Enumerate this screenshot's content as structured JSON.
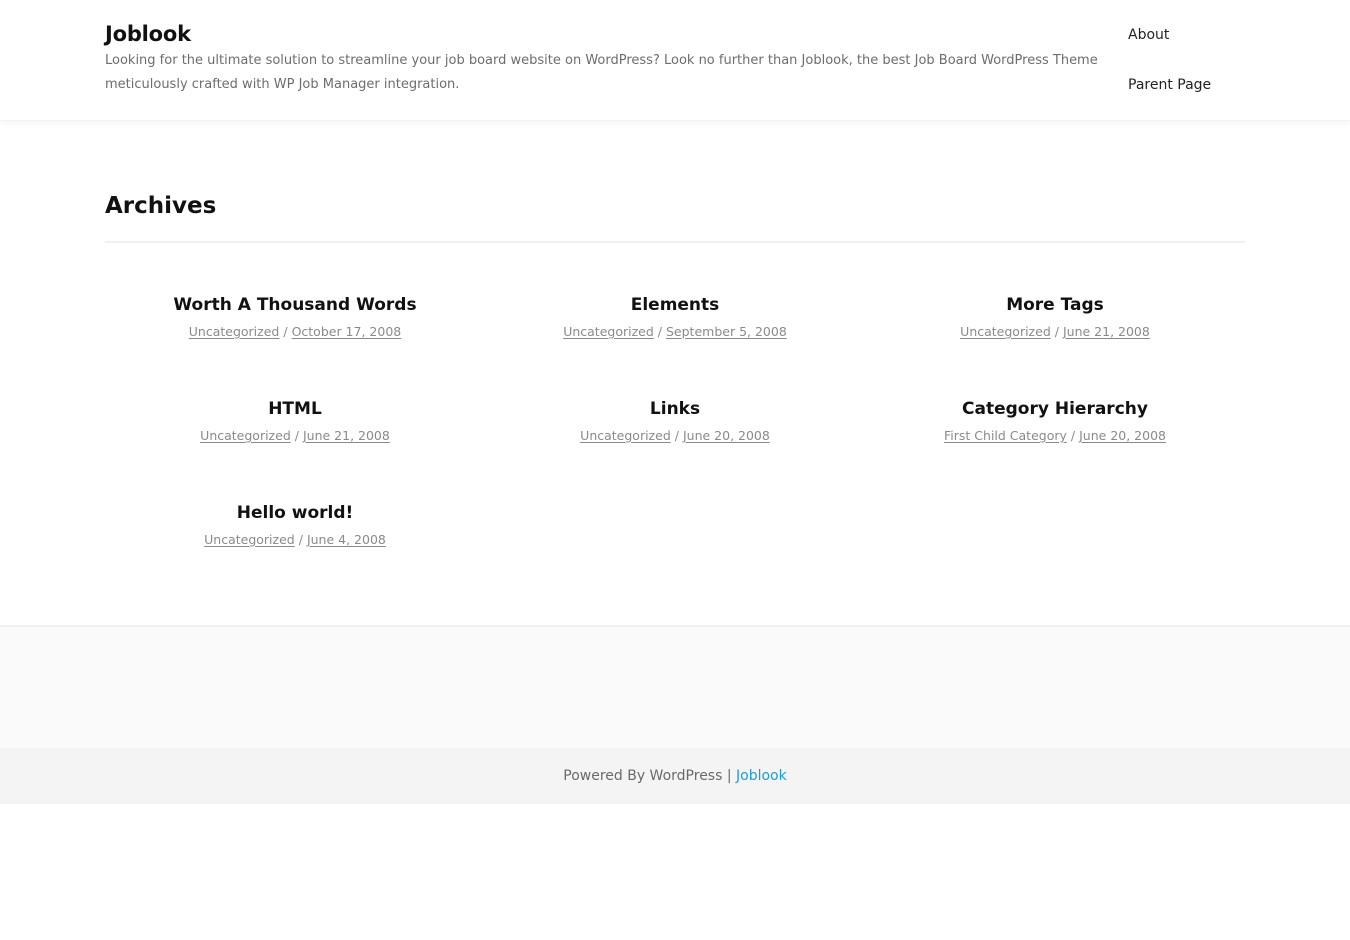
{
  "header": {
    "site_title": "Joblook",
    "site_description": "Looking for the ultimate solution to streamline your job board website on WordPress? Look no further than Joblook, the best Job Board WordPress Theme meticulously crafted with WP Job Manager integration.",
    "nav": [
      {
        "label": "About"
      },
      {
        "label": "Parent Page"
      }
    ]
  },
  "main": {
    "page_title": "Archives",
    "posts": [
      {
        "title": "Worth A Thousand Words",
        "category": "Uncategorized",
        "date": "October 17, 2008"
      },
      {
        "title": "Elements",
        "category": "Uncategorized",
        "date": "September 5, 2008"
      },
      {
        "title": "More Tags",
        "category": "Uncategorized",
        "date": "June 21, 2008"
      },
      {
        "title": "HTML",
        "category": "Uncategorized",
        "date": "June 21, 2008"
      },
      {
        "title": "Links",
        "category": "Uncategorized",
        "date": "June 20, 2008"
      },
      {
        "title": "Category Hierarchy",
        "category": "First Child Category",
        "date": "June 20, 2008"
      },
      {
        "title": "Hello world!",
        "category": "Uncategorized",
        "date": "June 4, 2008"
      }
    ],
    "meta_separator": "/"
  },
  "footer": {
    "powered_by": "Powered By WordPress |",
    "theme_link": "Joblook"
  },
  "colors": {
    "link_accent": "#1a9ed9",
    "meta_text": "#8a8a8a",
    "footer_bg": "#f4f4f4"
  }
}
